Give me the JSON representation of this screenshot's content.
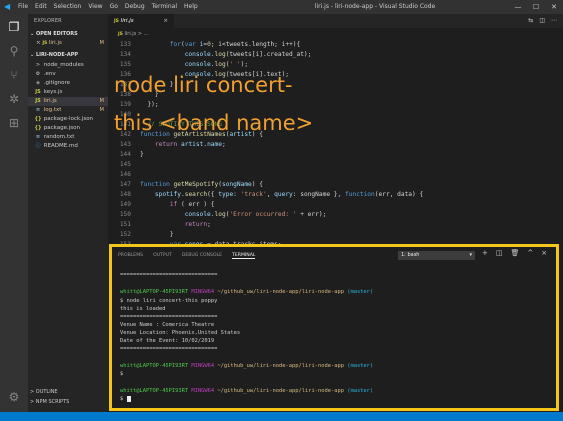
{
  "titlebar": {
    "menu": [
      "File",
      "Edit",
      "Selection",
      "View",
      "Go",
      "Debug",
      "Terminal",
      "Help"
    ],
    "window_title": "liri.js - liri-node-app - Visual Studio Code",
    "minimize": "—",
    "maximize": "☐",
    "close": "✕"
  },
  "sidebar": {
    "explorer_label": "EXPLORER",
    "open_editors_label": "OPEN EDITORS",
    "open_editor_file": "liri.js",
    "open_editor_badge": "M",
    "project_label": "LIRI-NODE-APP",
    "files": [
      {
        "icon": ">",
        "name": "node_modules",
        "badge": ""
      },
      {
        "icon": "⚙",
        "name": ".env",
        "badge": ""
      },
      {
        "icon": "◆",
        "name": ".gitignore",
        "badge": ""
      },
      {
        "icon": "JS",
        "name": "keys.js",
        "badge": ""
      },
      {
        "icon": "JS",
        "name": "liri.js",
        "badge": "M"
      },
      {
        "icon": "≡",
        "name": "log.txt",
        "badge": "M"
      },
      {
        "icon": "{}",
        "name": "package-lock.json",
        "badge": ""
      },
      {
        "icon": "{}",
        "name": "package.json",
        "badge": ""
      },
      {
        "icon": "≡",
        "name": "random.txt",
        "badge": ""
      },
      {
        "icon": "ⓘ",
        "name": "README.md",
        "badge": ""
      }
    ],
    "outline_label": "OUTLINE",
    "npm_label": "NPM SCRIPTS"
  },
  "editor": {
    "tab_icon": "JS",
    "tab_label": "liri.js",
    "tab_close": "×",
    "breadcrumb": "liri.js > ...",
    "lines": [
      {
        "n": "133",
        "parts": [
          [
            "tx",
            "        "
          ],
          [
            "kw",
            "for"
          ],
          [
            "tx",
            "("
          ],
          [
            "kw",
            "var"
          ],
          [
            "vr",
            " i"
          ],
          [
            "tx",
            "="
          ],
          [
            "nm",
            "0"
          ],
          [
            "tx",
            "; i<tweets.length; i++){"
          ]
        ]
      },
      {
        "n": "134",
        "parts": [
          [
            "tx",
            "            "
          ],
          [
            "vr",
            "console"
          ],
          [
            "tx",
            "."
          ],
          [
            "fn",
            "log"
          ],
          [
            "tx",
            "(tweets[i].created_at);"
          ]
        ]
      },
      {
        "n": "135",
        "parts": [
          [
            "tx",
            "            "
          ],
          [
            "vr",
            "console"
          ],
          [
            "tx",
            "."
          ],
          [
            "fn",
            "log"
          ],
          [
            "tx",
            "("
          ],
          [
            "st",
            "' '"
          ],
          [
            "tx",
            ");"
          ]
        ]
      },
      {
        "n": "136",
        "parts": [
          [
            "tx",
            "            "
          ],
          [
            "vr",
            "console"
          ],
          [
            "tx",
            "."
          ],
          [
            "fn",
            "log"
          ],
          [
            "tx",
            "(tweets[i].text);"
          ]
        ]
      },
      {
        "n": "137",
        "parts": [
          [
            "tx",
            "        }"
          ]
        ]
      },
      {
        "n": "138",
        "parts": [
          [
            "tx",
            "    }"
          ]
        ]
      },
      {
        "n": "139",
        "parts": [
          [
            "tx",
            "  });"
          ]
        ]
      },
      {
        "n": "140",
        "parts": [
          [
            "tx",
            ""
          ]
        ]
      },
      {
        "n": "141",
        "parts": [
          [
            "cm",
            "  // SPOTIFY THIS SONG"
          ]
        ]
      },
      {
        "n": "142",
        "parts": [
          [
            "kw",
            "function"
          ],
          [
            "fn",
            " getArtistNames"
          ],
          [
            "tx",
            "("
          ],
          [
            "vr",
            "artist"
          ],
          [
            "tx",
            ") {"
          ]
        ]
      },
      {
        "n": "143",
        "parts": [
          [
            "tx",
            "    "
          ],
          [
            "ct",
            "return"
          ],
          [
            "vr",
            " artist"
          ],
          [
            "tx",
            "."
          ],
          [
            "vr",
            "name"
          ],
          [
            "tx",
            ";"
          ]
        ]
      },
      {
        "n": "144",
        "parts": [
          [
            "tx",
            "}"
          ]
        ]
      },
      {
        "n": "145",
        "parts": [
          [
            "tx",
            ""
          ]
        ]
      },
      {
        "n": "146",
        "parts": [
          [
            "tx",
            ""
          ]
        ]
      },
      {
        "n": "147",
        "parts": [
          [
            "kw",
            "function"
          ],
          [
            "fn",
            " getMeSpotify"
          ],
          [
            "tx",
            "("
          ],
          [
            "vr",
            "songName"
          ],
          [
            "tx",
            ") {"
          ]
        ]
      },
      {
        "n": "148",
        "parts": [
          [
            "tx",
            "    "
          ],
          [
            "vr",
            "spotify"
          ],
          [
            "tx",
            "."
          ],
          [
            "fn",
            "search"
          ],
          [
            "tx",
            "({ "
          ],
          [
            "vr",
            "type"
          ],
          [
            "tx",
            ": "
          ],
          [
            "st",
            "'track'"
          ],
          [
            "tx",
            ", "
          ],
          [
            "vr",
            "query"
          ],
          [
            "tx",
            ": songName }, "
          ],
          [
            "kw",
            "function"
          ],
          [
            "tx",
            "(err, data) {"
          ]
        ]
      },
      {
        "n": "149",
        "parts": [
          [
            "tx",
            "        "
          ],
          [
            "ct",
            "if"
          ],
          [
            "tx",
            " ( err ) {"
          ]
        ]
      },
      {
        "n": "150",
        "parts": [
          [
            "tx",
            "            "
          ],
          [
            "vr",
            "console"
          ],
          [
            "tx",
            "."
          ],
          [
            "fn",
            "log"
          ],
          [
            "tx",
            "("
          ],
          [
            "st",
            "'Error occurred: '"
          ],
          [
            "tx",
            " + err);"
          ]
        ]
      },
      {
        "n": "151",
        "parts": [
          [
            "tx",
            "            "
          ],
          [
            "ct",
            "return"
          ],
          [
            "tx",
            ";"
          ]
        ]
      },
      {
        "n": "152",
        "parts": [
          [
            "tx",
            "        }"
          ]
        ]
      },
      {
        "n": "153",
        "parts": [
          [
            "tx",
            "        "
          ],
          [
            "kw",
            "var"
          ],
          [
            "vr",
            " songs"
          ],
          [
            "tx",
            " = data.tracks.items;"
          ]
        ]
      }
    ]
  },
  "overlay": {
    "line1": "node liri concert-",
    "line2": "this <band name>"
  },
  "panel": {
    "tabs": [
      "PROBLEMS",
      "OUTPUT",
      "DEBUG CONSOLE",
      "TERMINAL"
    ],
    "active_tab": "TERMINAL",
    "shell_select": "1: bash",
    "shell_caret": "▾",
    "tools": [
      "+",
      "◫",
      "🗑",
      "^",
      "×"
    ],
    "prompt_user": "whitt@LAPTOP-45PI93RT",
    "prompt_env": "MINGW64",
    "prompt_path": "~/github_uw/liri-node-app/liri-node-app",
    "prompt_branch": "(master)",
    "separator": "==============================",
    "command": "$ node liri concert-this poppy",
    "loaded": "this is loaded",
    "venue_name": "Venue Name : Comerica Theatre",
    "venue_location": "Venue Location: Phoenix,United States",
    "event_date": "Date of the Event: 10/02/2019",
    "dollar": "$"
  }
}
